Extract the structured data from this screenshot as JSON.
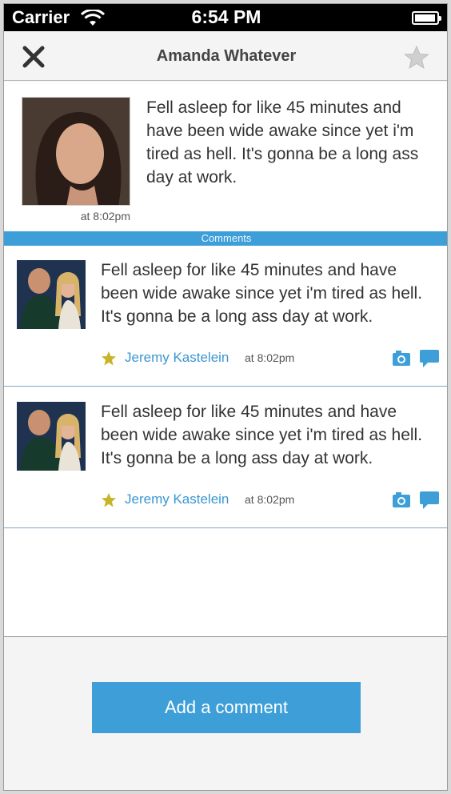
{
  "status_bar": {
    "carrier": "Carrier",
    "time": "6:54 PM"
  },
  "nav": {
    "title": "Amanda Whatever",
    "close_icon": "close-icon",
    "favorite_icon": "star-icon"
  },
  "post": {
    "text": "Fell asleep for like 45 minutes and have been wide awake since yet i'm tired as hell. It's gonna be a long ass day at work.",
    "time": "at 8:02pm"
  },
  "comments_header": "Comments",
  "comments": [
    {
      "text": "Fell asleep for like 45 minutes and have been wide awake since yet i'm tired as hell. It's gonna be a long ass day at work.",
      "author": "Jeremy Kastelein",
      "time": "at 8:02pm"
    },
    {
      "text": "Fell asleep for like 45 minutes and have been wide awake since yet i'm tired as hell. It's gonna be a long ass day at work.",
      "author": "Jeremy Kastelein",
      "time": "at 8:02pm"
    }
  ],
  "footer": {
    "add_comment_label": "Add a comment"
  },
  "colors": {
    "accent": "#3e9fd8",
    "star": "#c8b428",
    "text": "#333333"
  }
}
